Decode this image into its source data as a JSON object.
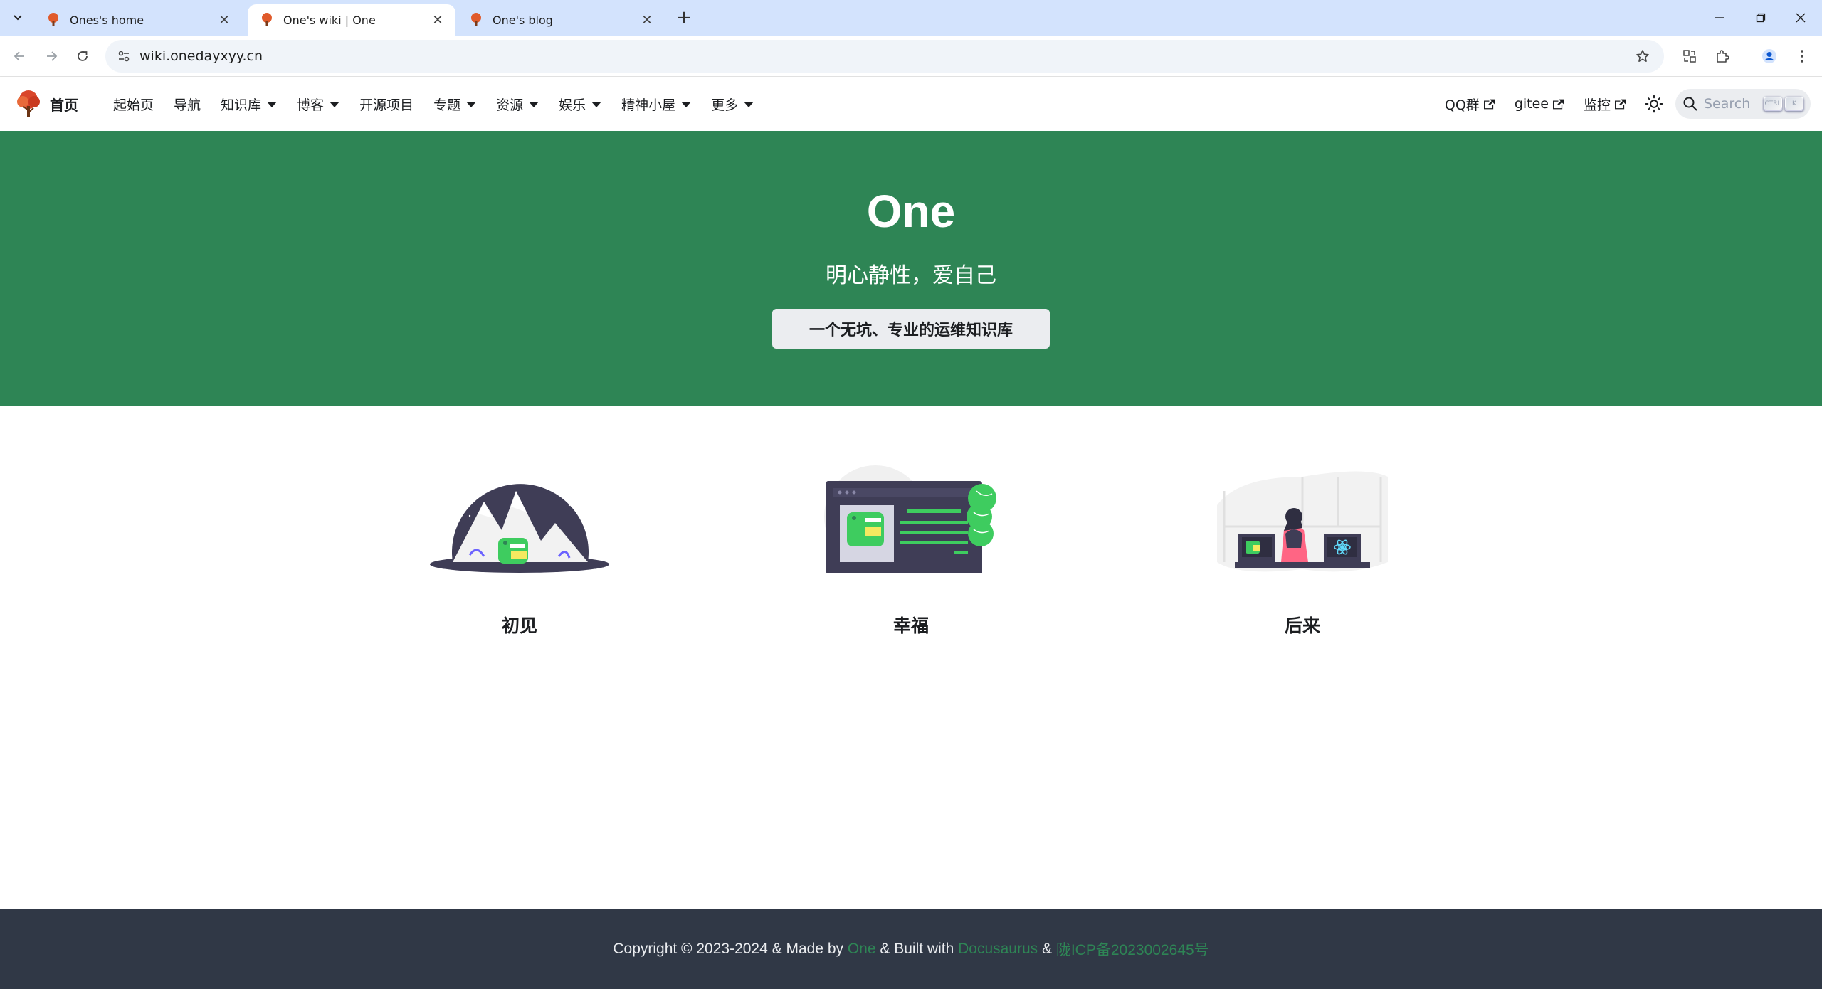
{
  "browser": {
    "tabs": [
      {
        "title": "Ones's home",
        "active": false
      },
      {
        "title": "One's wiki | One",
        "active": true
      },
      {
        "title": "One's blog",
        "active": false
      }
    ],
    "url": "wiki.onedayxyy.cn",
    "new_tab": "+",
    "close_glyph": "✕"
  },
  "navbar": {
    "brand_title": "首页",
    "items": [
      {
        "label": "起始页",
        "dropdown": false
      },
      {
        "label": "导航",
        "dropdown": false
      },
      {
        "label": "知识库",
        "dropdown": true
      },
      {
        "label": "博客",
        "dropdown": true
      },
      {
        "label": "开源项目",
        "dropdown": false
      },
      {
        "label": "专题",
        "dropdown": true
      },
      {
        "label": "资源",
        "dropdown": true
      },
      {
        "label": "娱乐",
        "dropdown": true
      },
      {
        "label": "精神小屋",
        "dropdown": true
      },
      {
        "label": "更多",
        "dropdown": true
      }
    ],
    "external_links": [
      {
        "label": "QQ群"
      },
      {
        "label": "gitee"
      },
      {
        "label": "监控"
      }
    ],
    "search": {
      "placeholder": "Search",
      "key_ctrl": "CTRL",
      "key_k": "K"
    }
  },
  "hero": {
    "title": "One",
    "tagline": "明心静性，爱自己",
    "button_label": "一个无坑、专业的运维知识库"
  },
  "features": [
    {
      "title": "初见",
      "icon": "mountain-illustration"
    },
    {
      "title": "幸福",
      "icon": "tree-screen-illustration"
    },
    {
      "title": "后来",
      "icon": "developer-desk-illustration"
    }
  ],
  "footer": {
    "part1": "Copyright © 2023-2024 & Made by ",
    "link_one": "One",
    "part2": " & Built with ",
    "link_docusaurus": "Docusaurus",
    "part3": " & ",
    "link_icp": "陇ICP备2023002645号"
  },
  "colors": {
    "primary": "#2e8555",
    "footer_bg": "#303846",
    "tabstrip_bg": "#d3e3fd"
  }
}
